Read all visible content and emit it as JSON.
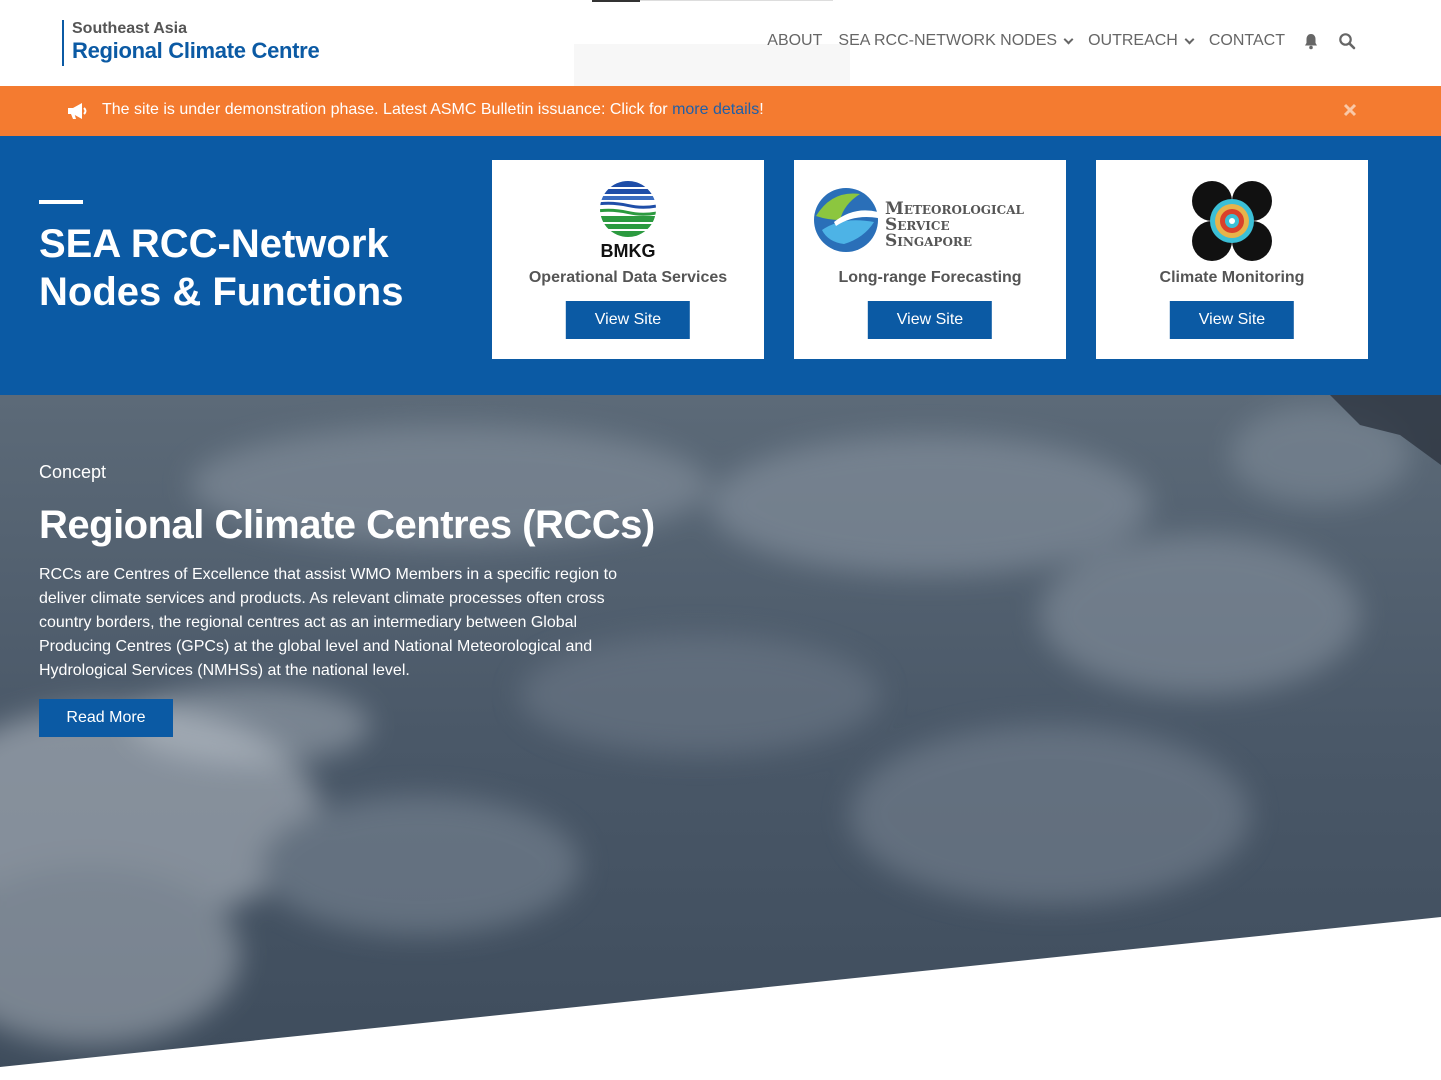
{
  "header": {
    "logo_small": "Southeast Asia",
    "logo_big": "Regional Climate Centre",
    "nav": [
      {
        "label": "ABOUT"
      },
      {
        "label": "SEA RCC-NETWORK NODES"
      },
      {
        "label": "OUTREACH"
      },
      {
        "label": "CONTACT"
      }
    ],
    "icons": [
      "bell-icon",
      "search-icon"
    ]
  },
  "notice": {
    "text": "The site is under demonstration phase. Latest ASMC Bulletin issuance: Click for ",
    "link": "more details",
    "suffix": "!",
    "colors": {
      "background": "#f47b30",
      "link": "#1f5fa8"
    }
  },
  "nodes": {
    "title_line1": "SEA RCC-Network",
    "title_line2": "Nodes & Functions",
    "cards": [
      {
        "org": "BMKG",
        "label": "Operational Data Services",
        "button": "View Site"
      },
      {
        "org_line1": "Meteorological",
        "org_line2": "Service",
        "org_line3": "Singapore",
        "label": "Long-range Forecasting",
        "button": "View Site"
      },
      {
        "label": "Climate Monitoring",
        "button": "View Site"
      }
    ],
    "colors": {
      "band": "#0b5aa4"
    }
  },
  "hero": {
    "eyebrow": "Concept",
    "title": "Regional Climate Centres (RCCs)",
    "body": "RCCs are Centres of Excellence that assist WMO Members in a specific region to deliver climate services and products. As relevant climate processes often cross country borders, the regional centres act as an intermediary between Global Producing Centres (GPCs) at the global level and National Meteorological and Hydrological Services (NMHSs) at the national level.",
    "button": "Read More"
  }
}
